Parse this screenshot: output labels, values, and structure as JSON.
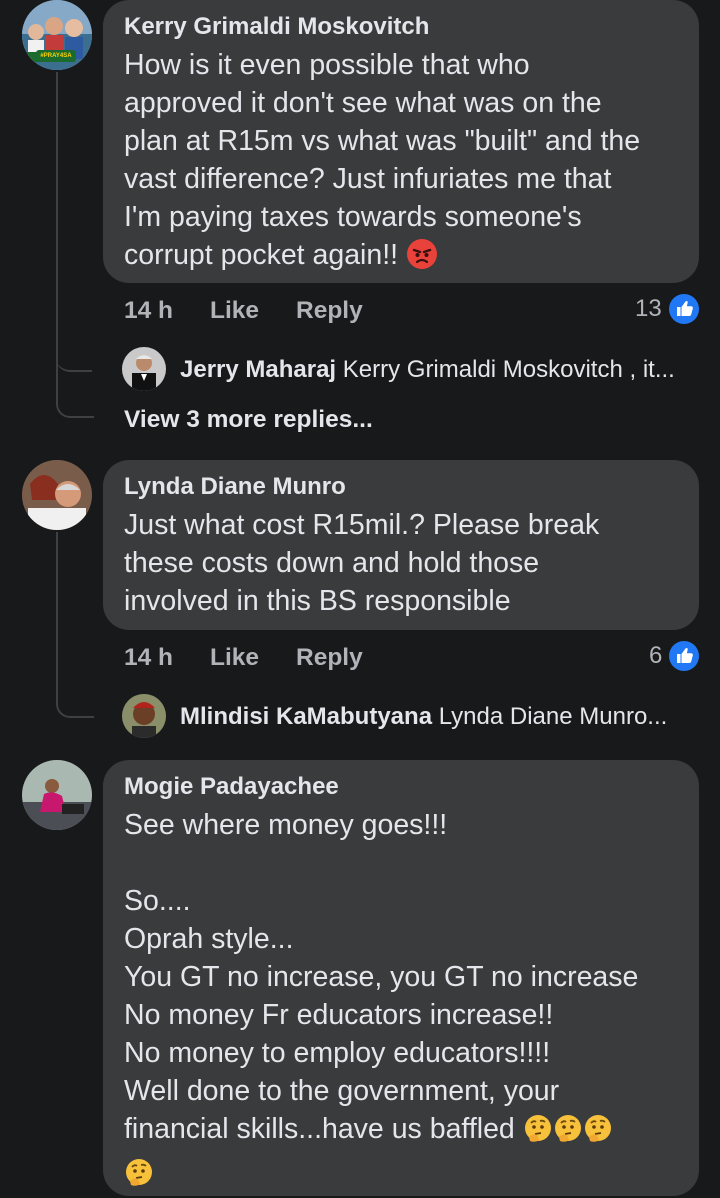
{
  "comments": [
    {
      "author": "Kerry Grimaldi Moskovitch",
      "text_lines": [
        "How is it even possible that who",
        "approved it don't see what was on the",
        "plan at R15m vs what was \"built\" and the",
        "vast difference? Just infuriates me that",
        "I'm paying taxes towards someone's",
        "corrupt pocket again!!"
      ],
      "emoji": "angry-face",
      "time": "14 h",
      "like_label": "Like",
      "reply_label": "Reply",
      "reaction_count": "13",
      "reply_preview": {
        "author": "Jerry Maharaj",
        "text": "Kerry Grimaldi Moskovitch , it..."
      },
      "view_more": "View 3 more replies..."
    },
    {
      "author": "Lynda Diane Munro",
      "text_lines": [
        "Just what cost R15mil.? Please break",
        "these costs down and hold those",
        "involved in this BS responsible"
      ],
      "time": "14 h",
      "like_label": "Like",
      "reply_label": "Reply",
      "reaction_count": "6",
      "reply_preview": {
        "author": "Mlindisi KaMabutyana",
        "text": "Lynda Diane Munro..."
      }
    },
    {
      "author": "Mogie Padayachee",
      "text_lines": [
        "See where money goes!!!",
        "",
        "So....",
        "Oprah style...",
        "You GT no increase, you GT no increase",
        "No money Fr educators increase!!",
        "No money to employ educators!!!!",
        "Well done to the government, your",
        "financial skills...have us baffled"
      ],
      "emoji": "thinking-face"
    }
  ],
  "avatar_badge_text": "#PRAY4SA",
  "colors": {
    "background": "#18191a",
    "bubble": "#3a3b3c",
    "like_blue": "#2078f4"
  }
}
